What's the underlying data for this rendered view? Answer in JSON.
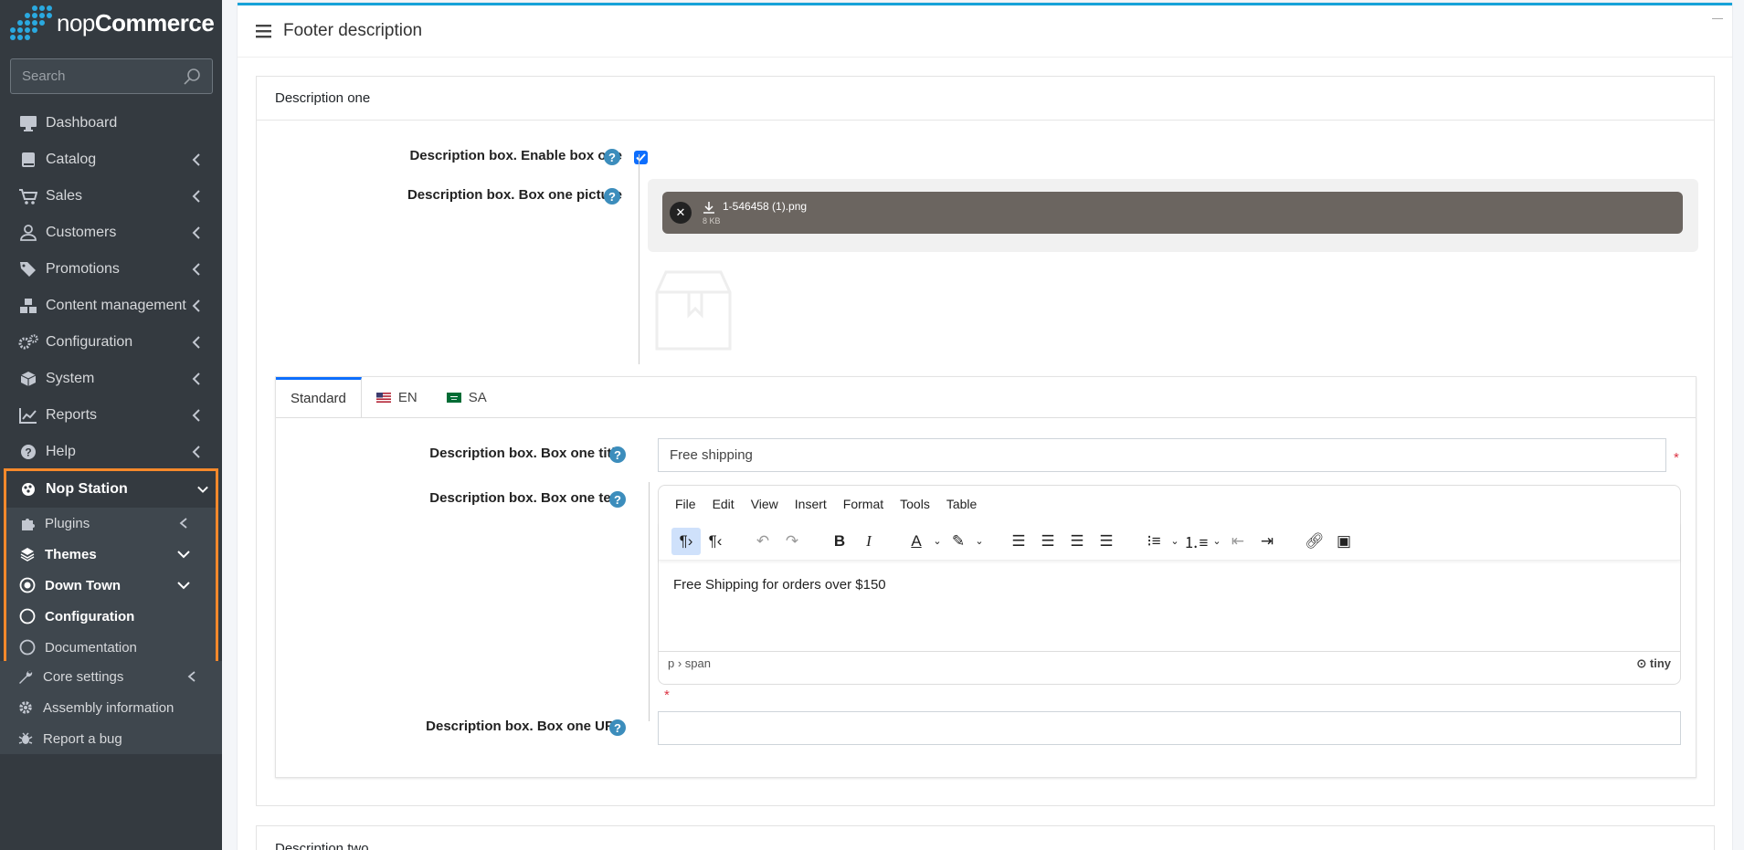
{
  "brand": {
    "name_light": "nop",
    "name_bold": "Commerce"
  },
  "search": {
    "placeholder": "Search"
  },
  "nav": [
    {
      "label": "Dashboard",
      "icon": "monitor-icon"
    },
    {
      "label": "Catalog",
      "icon": "book-icon"
    },
    {
      "label": "Sales",
      "icon": "cart-icon"
    },
    {
      "label": "Customers",
      "icon": "user-icon"
    },
    {
      "label": "Promotions",
      "icon": "tags-icon"
    },
    {
      "label": "Content management",
      "icon": "cubes-icon"
    },
    {
      "label": "Configuration",
      "icon": "gears-icon"
    },
    {
      "label": "System",
      "icon": "cube-icon"
    },
    {
      "label": "Reports",
      "icon": "chart-line-icon"
    },
    {
      "label": "Help",
      "icon": "question-icon"
    }
  ],
  "nopstation": {
    "label": "Nop Station",
    "plugins": "Plugins",
    "themes": "Themes",
    "downtown": "Down Town",
    "configuration": "Configuration",
    "documentation": "Documentation"
  },
  "bottom_nav": {
    "core": "Core settings",
    "assembly": "Assembly information",
    "bug": "Report a bug"
  },
  "card": {
    "title": "Footer description"
  },
  "panel": {
    "title": "Description one"
  },
  "fields": {
    "enable_label": "Description box. Enable box one",
    "picture_label": "Description box. Box one picture",
    "title_label": "Description box. Box one title",
    "text_label": "Description box. Box one text",
    "url_label": "Description box. Box one URL",
    "title_value": "Free shipping",
    "url_value": ""
  },
  "file": {
    "name": "1-546458 (1).png",
    "size": "8 KB"
  },
  "tabs": [
    {
      "label": "Standard"
    },
    {
      "label": "EN"
    },
    {
      "label": "SA"
    }
  ],
  "editor": {
    "menu": [
      "File",
      "Edit",
      "View",
      "Insert",
      "Format",
      "Tools",
      "Table"
    ],
    "content": "Free Shipping for orders over $150",
    "path": "p › span",
    "brand": "tiny"
  },
  "panel2": {
    "title": "Description two"
  },
  "colors": {
    "accent": "#17a2d8",
    "highlight_box": "#f7892b",
    "sidebar": "#343a40"
  }
}
